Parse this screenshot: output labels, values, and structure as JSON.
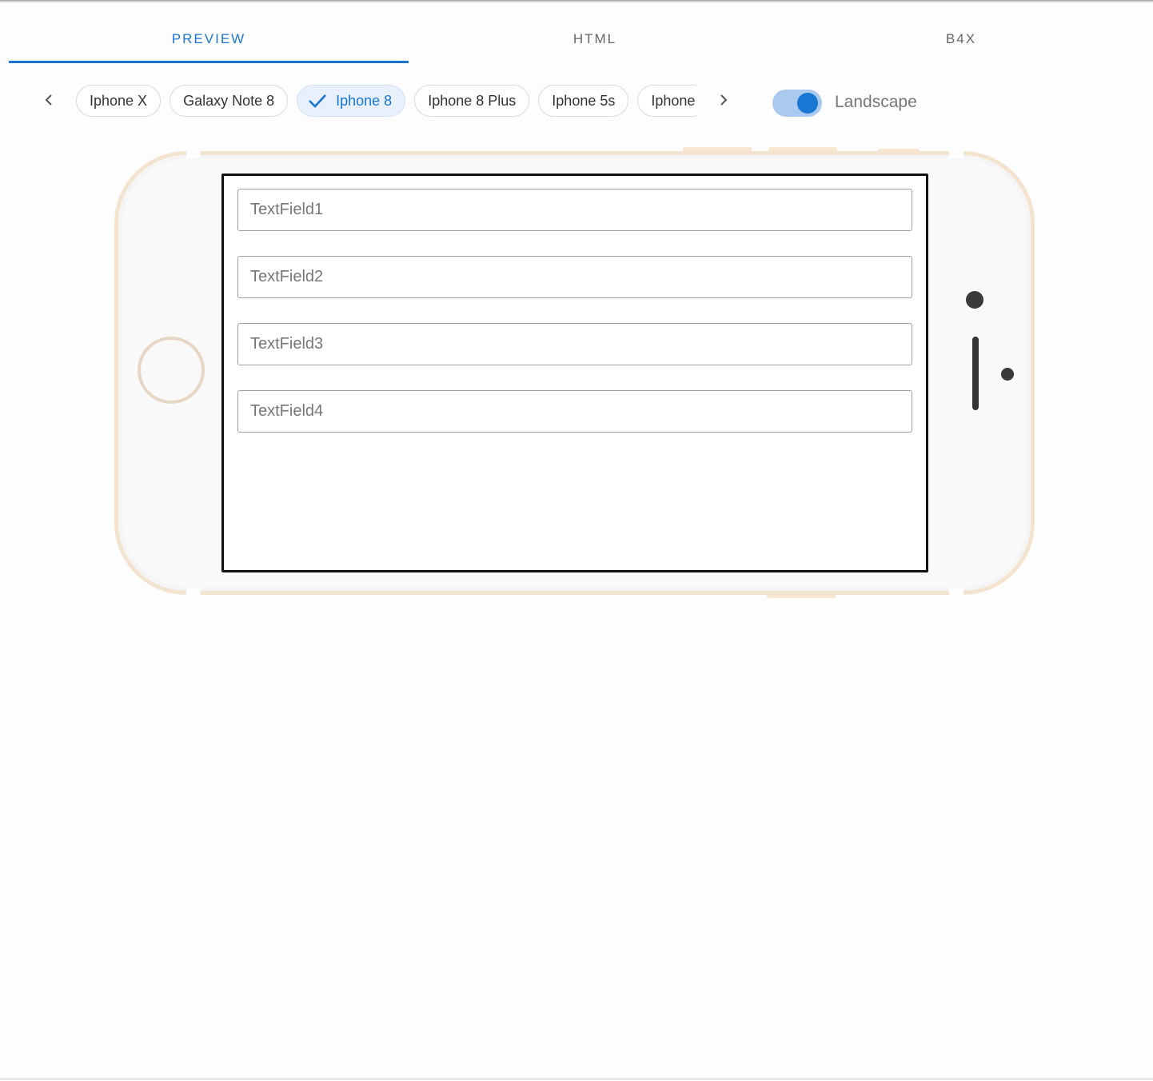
{
  "tabs": [
    {
      "label": "PREVIEW",
      "active": true
    },
    {
      "label": "HTML",
      "active": false
    },
    {
      "label": "B4X",
      "active": false
    }
  ],
  "devices": {
    "items": [
      "Iphone X",
      "Galaxy Note 8",
      "Iphone 8",
      "Iphone 8 Plus",
      "Iphone 5s",
      "Iphone"
    ],
    "selected": "Iphone 8",
    "prev_icon": "chevron-left-icon",
    "next_icon": "chevron-right-icon",
    "check_icon": "check-icon"
  },
  "orientation": {
    "label": "Landscape",
    "enabled": true
  },
  "preview": {
    "fields": [
      {
        "placeholder": "TextField1"
      },
      {
        "placeholder": "TextField2"
      },
      {
        "placeholder": "TextField3"
      },
      {
        "placeholder": "TextField4"
      }
    ]
  },
  "colors": {
    "accent": "#1976d2",
    "chip_selected_bg": "#e8f0fb",
    "phone_frame": "#f4e4cf",
    "switch_track": "#a9c9ef"
  }
}
